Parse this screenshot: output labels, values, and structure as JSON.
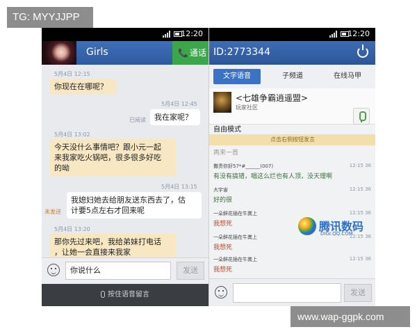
{
  "watermarks": {
    "top": "TG: MYYJJPP",
    "bottom": "www.wap-ggpk.com"
  },
  "left": {
    "status": {
      "time": "12:20"
    },
    "header": {
      "title": "Girls",
      "call_label": "通话",
      "call_icon": "📞"
    },
    "messages": [
      {
        "time": "5月4日  12:15",
        "text": "你现在在哪呢？"
      },
      {
        "time": "5月4日  12:45",
        "status": "已阅读",
        "text": "我在家呢？"
      },
      {
        "time": "5月4日  13:02",
        "text1": "今天没什么事情吧？跟小元一起",
        "text2": "来我家吃火锅吧，很多很多好吃",
        "text3": "的呦"
      },
      {
        "time": "5月4日  13:15",
        "status": "未发送",
        "text1": "我媳妇她去给朋友送东西去了，估",
        "text2": "计要5点左右才回来呢"
      },
      {
        "time": "5月4日  13:20",
        "text1": "那你先过来吧，我给弟妹打电话",
        "text2": "，让她一会直接来我家"
      }
    ],
    "input": {
      "value": "你说什么",
      "send_label": "发送"
    },
    "voice_label": "按住语音留言"
  },
  "right": {
    "status": {
      "time": "12:20"
    },
    "header": {
      "id": "ID:2773344"
    },
    "tabs": [
      "文字语音",
      "子频道",
      "在线马甲"
    ],
    "room": {
      "name": "<七雄争霸逍遥盟>",
      "subtitle": "玩家社区"
    },
    "mode": "自由模式",
    "hint": "点击右侧按钮发言",
    "partial": "再来一首",
    "messages": [
      {
        "name": "撒责你好57*#______(007)",
        "time": "12:15 36",
        "text": "有没有搞错，唱这么烂也有人顶，没天理啊",
        "color": "green"
      },
      {
        "name": "大宇宙",
        "time": "12:15 36",
        "text": "好的很",
        "color": "green"
      },
      {
        "name": "一朵鲜花插在牛粪上",
        "time": "12:15 36",
        "text": "我想死",
        "color": "red"
      },
      {
        "name": "一朵鲜花插在牛粪上",
        "time": "12:15 36",
        "text": "我想死",
        "color": "red"
      },
      {
        "name": "一朵鲜花插在牛粪上",
        "time": "12:15 36",
        "text": "我想死",
        "color": "red"
      }
    ],
    "logo": {
      "brand": "腾讯数码",
      "sub": "DIGI.QQ.COM"
    },
    "send_label": "发送"
  }
}
